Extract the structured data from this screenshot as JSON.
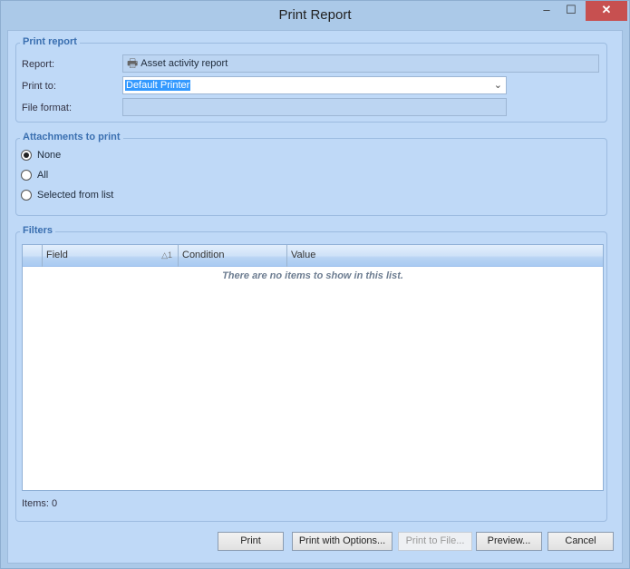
{
  "window": {
    "title": "Print Report",
    "minimize": "‒",
    "maximize": "☐",
    "close": "✕"
  },
  "print_report": {
    "legend": "Print report",
    "report_label": "Report:",
    "report_value": "Asset activity report",
    "print_to_label": "Print to:",
    "print_to_value": "Default Printer",
    "file_format_label": "File format:",
    "file_format_value": ""
  },
  "attachments": {
    "legend": "Attachments to print",
    "options": [
      {
        "label": "None",
        "selected": true
      },
      {
        "label": "All",
        "selected": false
      },
      {
        "label": "Selected from list",
        "selected": false
      }
    ]
  },
  "filters": {
    "legend": "Filters",
    "columns": [
      "Field",
      "Condition",
      "Value"
    ],
    "sort_indicator": "△1",
    "empty_text": "There are no items to show in this list.",
    "items_count": "Items: 0"
  },
  "buttons": {
    "print": "Print",
    "print_with_options": "Print with Options...",
    "print_to_file": "Print to File...",
    "preview": "Preview...",
    "cancel": "Cancel"
  }
}
